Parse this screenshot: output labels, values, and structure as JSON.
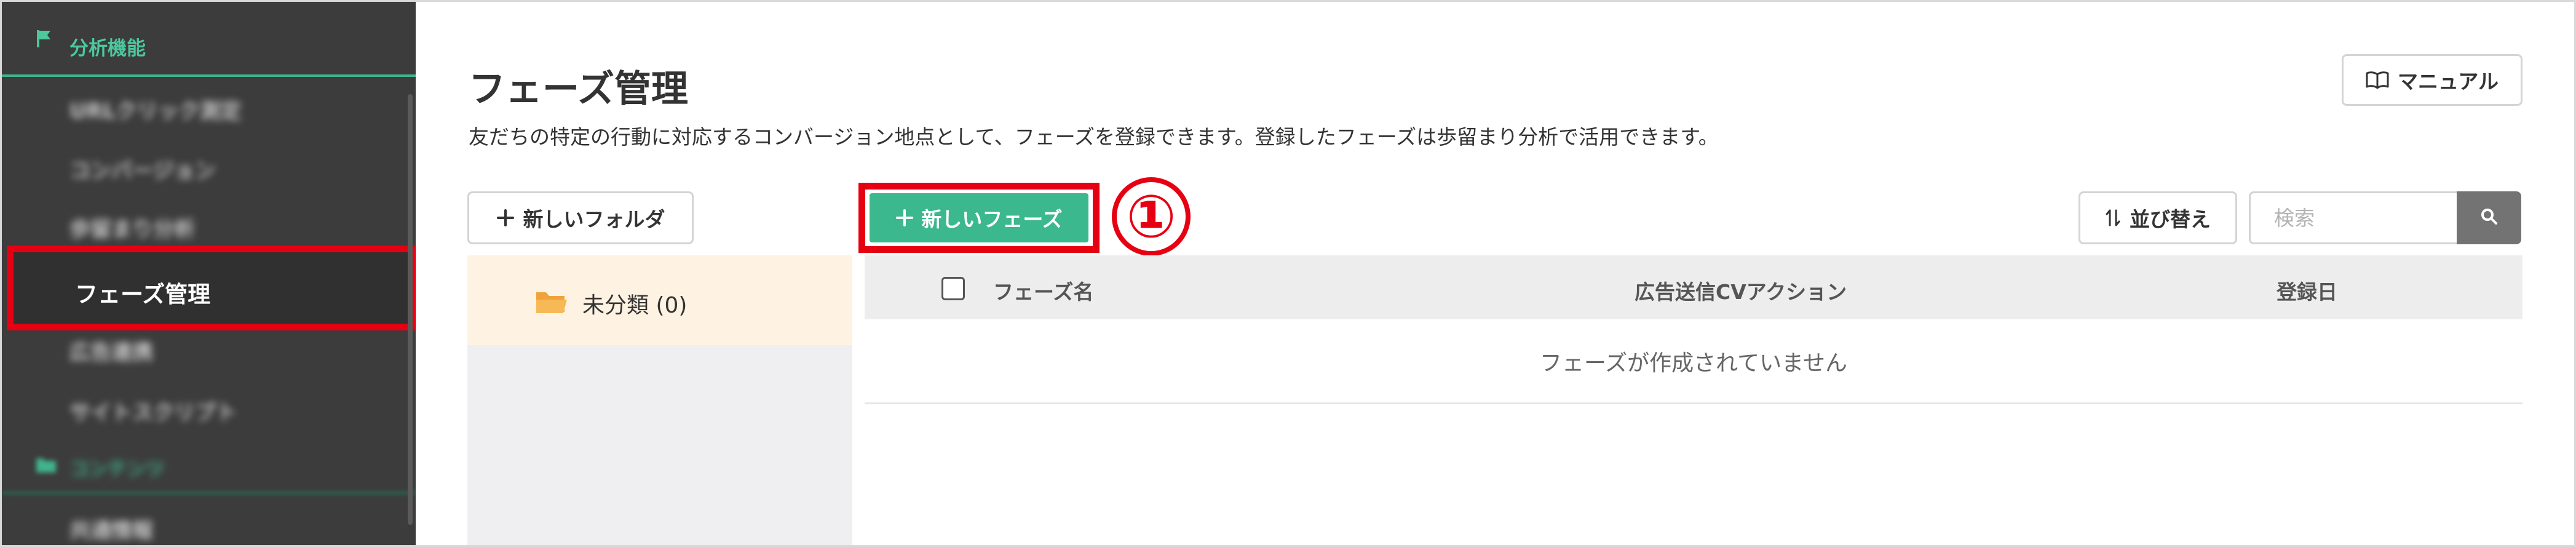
{
  "sidebar": {
    "section_title": "分析機能",
    "items": [
      "URLクリック測定",
      "コンバージョン",
      "歩留まり分析",
      "フェーズ管理",
      "広告連携",
      "サイトスクリプト"
    ],
    "section2_title": "コンテンツ",
    "bottom_item": "共通情報"
  },
  "page": {
    "title": "フェーズ管理",
    "description": "友だちの特定の行動に対応するコンバージョン地点として、フェーズを登録できます。登録したフェーズは歩留まり分析で活用できます。"
  },
  "toolbar": {
    "manual_label": "マニュアル",
    "new_folder_label": "新しいフォルダ",
    "new_phase_label": "新しいフェーズ",
    "sort_label": "並び替え",
    "search_placeholder": "検索"
  },
  "annotation": {
    "step_number": "①",
    "highlight_color": "#e60012"
  },
  "folders": [
    {
      "label": "未分類 (0)"
    }
  ],
  "table": {
    "columns": [
      "フェーズ名",
      "広告送信CVアクション",
      "登録日"
    ],
    "empty_message": "フェーズが作成されていません"
  },
  "colors": {
    "accent": "#3cb88f",
    "sidebar_bg": "#3c3c3c",
    "folder_selected_bg": "#fef3e3"
  },
  "icons": {
    "manual": "book-open-icon",
    "plus": "plus-icon",
    "sort": "sort-arrows-icon",
    "search": "search-icon",
    "folder": "folder-icon",
    "flag": "flag-icon"
  }
}
